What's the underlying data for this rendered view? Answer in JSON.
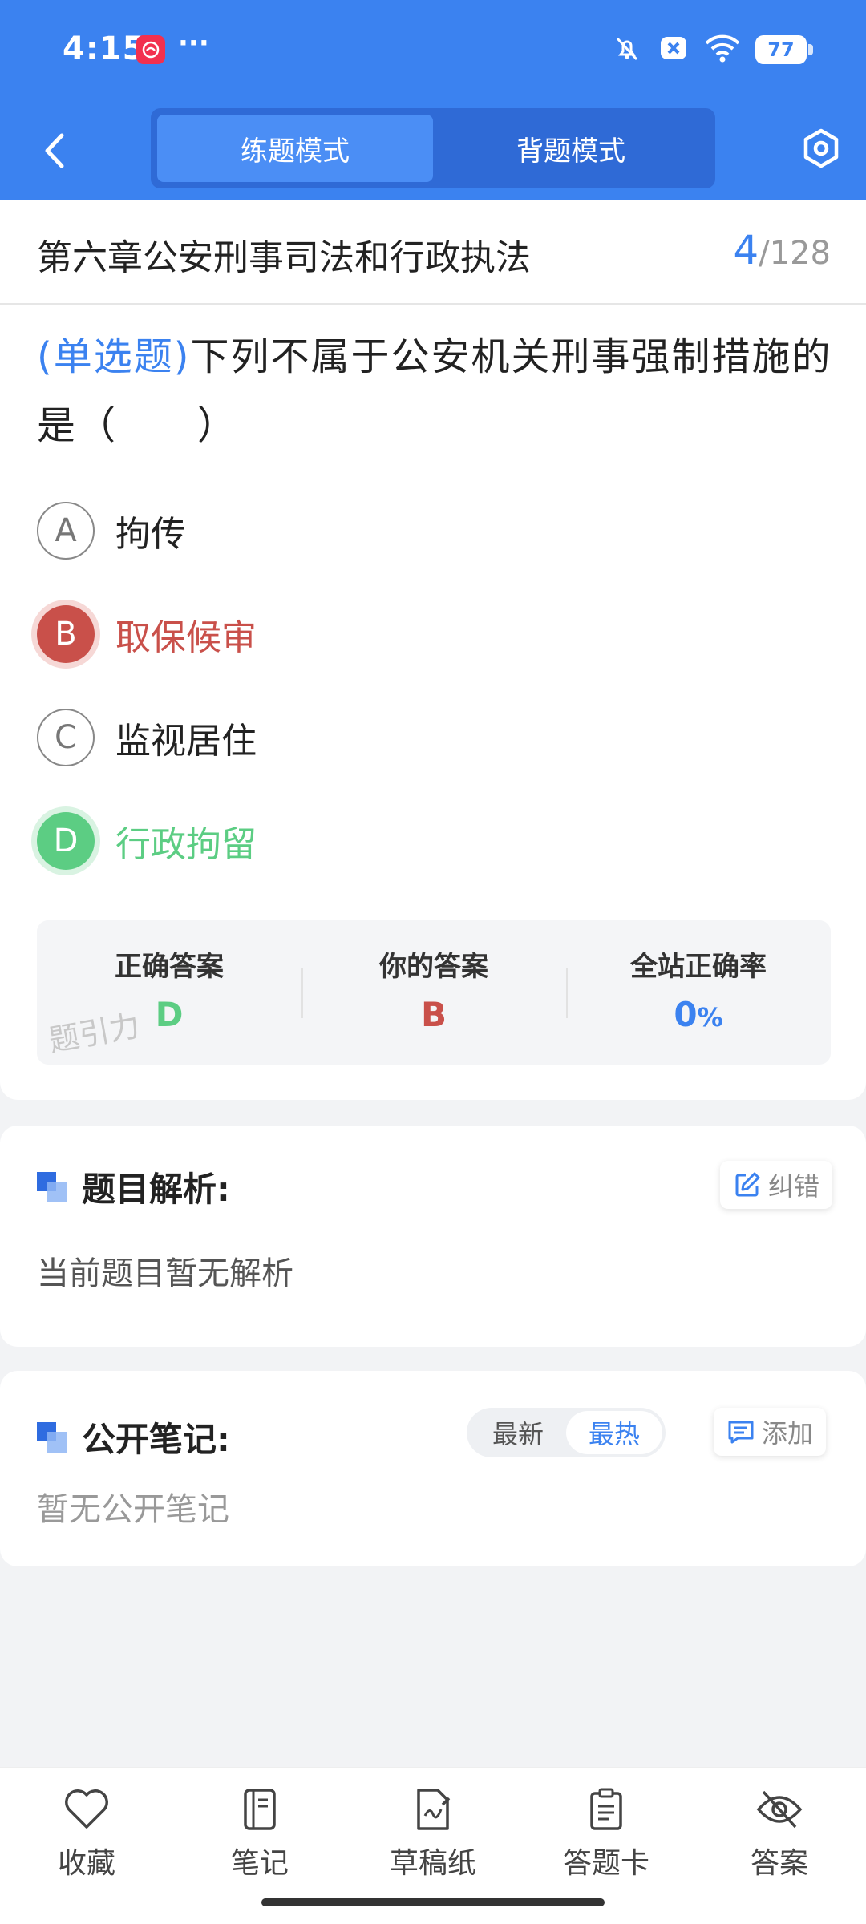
{
  "status_bar": {
    "time": "4:15",
    "dots": "···",
    "battery": "77"
  },
  "nav": {
    "tabs": [
      {
        "label": "练题模式",
        "active": true
      },
      {
        "label": "背题模式",
        "active": false
      }
    ]
  },
  "chapter": {
    "title": "第六章公安刑事司法和行政执法",
    "current": "4",
    "total": "/128"
  },
  "question": {
    "type": "(单选题)",
    "text": "下列不属于公安机关刑事强制措施的是（　　）"
  },
  "options": [
    {
      "letter": "A",
      "text": "拘传",
      "state": "normal"
    },
    {
      "letter": "B",
      "text": "取保候审",
      "state": "wrong"
    },
    {
      "letter": "C",
      "text": "监视居住",
      "state": "normal"
    },
    {
      "letter": "D",
      "text": "行政拘留",
      "state": "correct"
    }
  ],
  "answer_box": {
    "correct_label": "正确答案",
    "correct_value": "D",
    "yours_label": "你的答案",
    "yours_value": "B",
    "rate_label": "全站正确率",
    "rate_value": "0",
    "rate_unit": "%",
    "watermark": "题引力"
  },
  "analysis": {
    "title": "题目解析:",
    "correct_button": "纠错",
    "content": "当前题目暂无解析"
  },
  "notes": {
    "title": "公开笔记:",
    "sort_options": [
      "最新",
      "最热"
    ],
    "sort_active": "最热",
    "add_button": "添加",
    "empty": "暂无公开笔记"
  },
  "tabbar": [
    {
      "label": "收藏",
      "icon": "heart-icon"
    },
    {
      "label": "笔记",
      "icon": "notebook-icon"
    },
    {
      "label": "草稿纸",
      "icon": "draft-icon"
    },
    {
      "label": "答题卡",
      "icon": "answer-sheet-icon"
    },
    {
      "label": "答案",
      "icon": "eye-off-icon"
    }
  ],
  "colors": {
    "primary": "#3b82f0",
    "wrong": "#c9504a",
    "correct": "#5ccd83"
  }
}
